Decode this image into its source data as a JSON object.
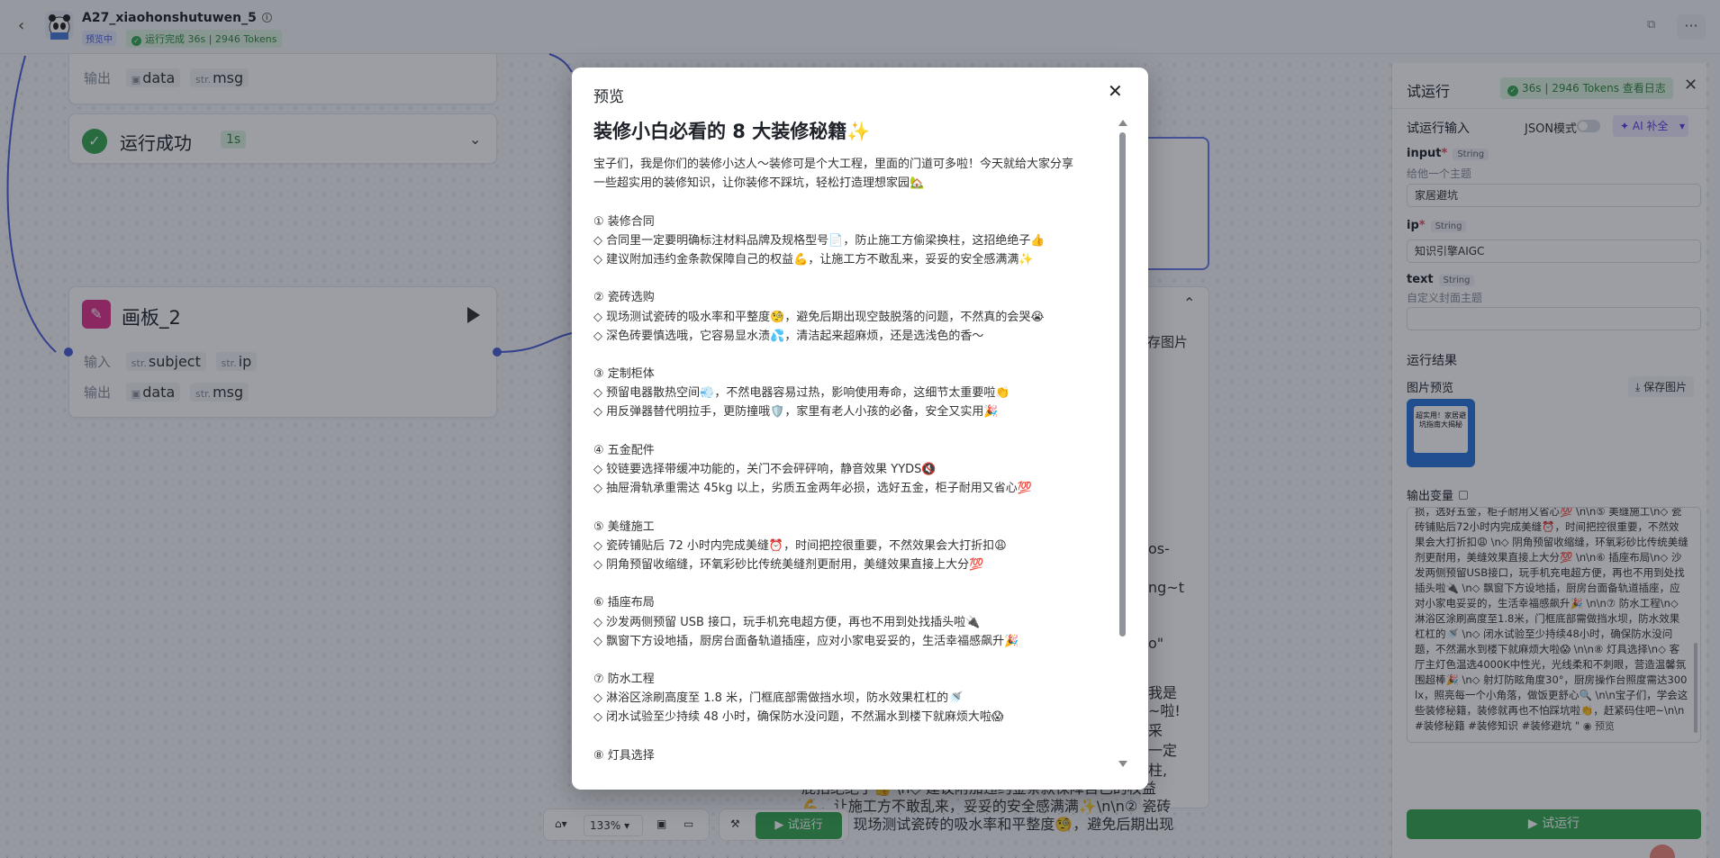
{
  "app": {
    "title": "A27_xiaohonshutuwen_5",
    "preview_tag": "预览中",
    "run_status": "运行完成 36s | 2946 Tokens"
  },
  "canvas": {
    "top_node": {
      "output_label": "输出",
      "outputs": [
        "data",
        "msg"
      ],
      "output_prefixes": [
        "",
        "str."
      ]
    },
    "success_node": {
      "title": "运行成功",
      "time": "1s"
    },
    "board_node": {
      "title": "画板_2",
      "input_label": "输入",
      "inputs": [
        "subject",
        "ip"
      ],
      "output_label": "输出",
      "outputs": [
        "data",
        "msg"
      ],
      "str_prefix": "str."
    },
    "bg_card_button": "存图片",
    "bg_text_lines": [
      "os-",
      "ng~t",
      "o\"",
      "我是",
      "~啦!",
      "采",
      "一定",
      "柱,",
      "屁招绝绝子👍 \\n◇ 建议附加违约金条款保障自己的权益",
      "💪，让施工方不敢乱来，妥妥的安全感满满✨\\n\\n② 瓷砖",
      "◇ 现场测试瓷砖的吸水率和平整度🧐，避免后期出现"
    ]
  },
  "toolbar": {
    "zoom": "133%",
    "run_label": "试运行"
  },
  "right_panel": {
    "title": "试运行",
    "log_text": "36s | 2946 Tokens  查看日志",
    "input_section": "试运行输入",
    "json_mode": "JSON模式",
    "ai_fill": "AI 补全",
    "fields": [
      {
        "name": "input",
        "required": true,
        "type": "String",
        "desc": "给他一个主题",
        "value": "家居避坑"
      },
      {
        "name": "ip",
        "required": true,
        "type": "String",
        "desc": "",
        "value": "知识引擎AIGC"
      },
      {
        "name": "text",
        "required": false,
        "type": "String",
        "desc": "自定义封面主题",
        "value": ""
      }
    ],
    "result_section": "运行结果",
    "image_preview": "图片预览",
    "save_image": "保存图片",
    "thumb_text": "超实用！家居避坑指南大揭秘",
    "output_vars": "输出变量",
    "output_text": "损，选好五金，柜子耐用又省心💯 \\n\\n⑤ 美缝施工\\n◇ 瓷砖铺贴后72小时内完成美缝⏰，时间把控很重要，不然效果会大打折扣😩 \\n◇ 阴角预留收缩缝，环氧彩砂比传统美缝剂更耐用，美缝效果直接上大分💯 \\n\\n⑥ 插座布局\\n◇ 沙发两侧预留USB接口，玩手机充电超方便，再也不用到处找插头啦🔌 \\n◇ 飘窗下方设地插，厨房台面备轨道插座，应对小家电妥妥的，生活幸福感飙升🎉 \\n\\n⑦ 防水工程\\n◇ 淋浴区涂刷高度至1.8米，门框底部需做挡水坝，防水效果杠杠的🚿 \\n◇ 闭水试验至少持续48小时，确保防水没问题，不然漏水到楼下就麻烦大啦😱 \\n\\n⑧ 灯具选择\\n◇ 客厅主灯色温选4000K中性光，光线柔和不刺眼，营造温馨氛围超棒🎉 \\n◇ 射灯防眩角度30°，厨房操作台照度需达300lx，照亮每一个小角落，做饭更舒心🔍 \\n\\n宝子们，学会这些装修秘籍，装修就再也不怕踩坑啦👏，赶紧码住吧~\\n\\n#装修秘籍 #装修知识 #装修避坑 \"",
    "output_preview_link": "预览",
    "run_button": "试运行"
  },
  "modal": {
    "title": "预览",
    "heading": "装修小白必看的 8 大装修秘籍✨",
    "lines": [
      "宝子们，我是你们的装修小达人～装修可是个大工程，里面的门道可多啦！今天就给大家分享",
      "一些超实用的装修知识，让你装修不踩坑，轻松打造理想家园🏡",
      "",
      "① 装修合同",
      "◇ 合同里一定要明确标注材料品牌及规格型号📄，防止施工方偷梁换柱，这招绝绝子👍",
      "◇ 建议附加违约金条款保障自己的权益💪，让施工方不敢乱来，妥妥的安全感满满✨",
      "",
      "② 瓷砖选购",
      "◇ 现场测试瓷砖的吸水率和平整度🧐，避免后期出现空鼓脱落的问题，不然真的会哭😭",
      "◇ 深色砖要慎选哦，它容易显水渍💦，清洁起来超麻烦，还是选浅色的香～",
      "",
      "③ 定制柜体",
      "◇ 预留电器散热空间💨，不然电器容易过热，影响使用寿命，这细节太重要啦👏",
      "◇ 用反弹器替代明拉手，更防撞哦🛡️，家里有老人小孩的必备，安全又实用🎉",
      "",
      "④ 五金配件",
      "◇ 铰链要选择带缓冲功能的，关门不会砰砰响，静音效果 YYDS🔇",
      "◇ 抽屉滑轨承重需达 45kg 以上，劣质五金两年必损，选好五金，柜子耐用又省心💯",
      "",
      "⑤ 美缝施工",
      "◇ 瓷砖铺贴后 72 小时内完成美缝⏰，时间把控很重要，不然效果会大打折扣😩",
      "◇ 阴角预留收缩缝，环氧彩砂比传统美缝剂更耐用，美缝效果直接上大分💯",
      "",
      "⑥ 插座布局",
      "◇ 沙发两侧预留 USB 接口，玩手机充电超方便，再也不用到处找插头啦🔌",
      "◇ 飘窗下方设地插，厨房台面备轨道插座，应对小家电妥妥的，生活幸福感飙升🎉",
      "",
      "⑦ 防水工程",
      "◇ 淋浴区涂刷高度至 1.8 米，门框底部需做挡水坝，防水效果杠杠的🚿",
      "◇ 闭水试验至少持续 48 小时，确保防水没问题，不然漏水到楼下就麻烦大啦😱",
      "",
      "⑧ 灯具选择"
    ]
  }
}
